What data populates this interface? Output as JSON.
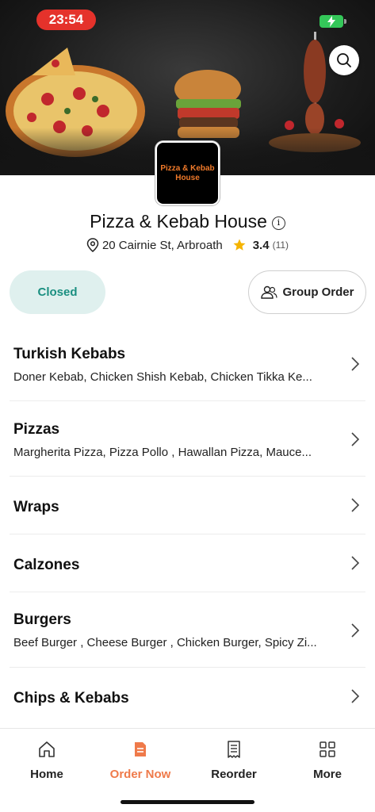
{
  "status_bar": {
    "time": "23:54"
  },
  "restaurant": {
    "logo_text": "Pizza & Kebab House",
    "name": "Pizza & Kebab House",
    "address": "20 Cairnie St, Arbroath",
    "rating": "3.4",
    "rating_count": "(11)",
    "status": "Closed",
    "group_order_label": "Group Order"
  },
  "categories": [
    {
      "title": "Turkish Kebabs",
      "items": "Doner Kebab, Chicken Shish Kebab, Chicken Tikka Ke..."
    },
    {
      "title": "Pizzas",
      "items": "Margherita Pizza, Pizza Pollo , Hawallan Pizza, Mauce..."
    },
    {
      "title": "Wraps",
      "items": ""
    },
    {
      "title": "Calzones",
      "items": ""
    },
    {
      "title": "Burgers",
      "items": "Beef Burger , Cheese Burger , Chicken Burger, Spicy Zi..."
    },
    {
      "title": "Chips & Kebabs",
      "items": ""
    }
  ],
  "tabs": [
    {
      "label": "Home",
      "icon": "home-icon"
    },
    {
      "label": "Order Now",
      "icon": "order-icon",
      "active": true
    },
    {
      "label": "Reorder",
      "icon": "receipt-icon"
    },
    {
      "label": "More",
      "icon": "grid-icon"
    }
  ],
  "colors": {
    "accent": "#ef7a4a",
    "closed_bg": "#dff0ee",
    "closed_text": "#1a8f80",
    "time_pill": "#e5322b",
    "star": "#f5b400"
  }
}
